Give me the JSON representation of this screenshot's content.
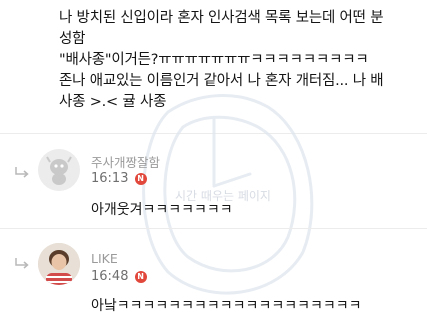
{
  "post": {
    "lines": [
      "나 방치된 신입이라 혼자 인사검색 목록 보는데 어떤 분",
      "성함",
      "\"배사종\"이거든?ㅠㅠㅠㅠㅠㅠㅠㅋㅋㅋㅋㅋㅋㅋㅋㅋ",
      "존나 애교있는 이름인거 같아서 나 혼자 개터짐... 나 배",
      "사종 >.< 귤 사종"
    ]
  },
  "watermark": {
    "text": "시간 때우는 페이지"
  },
  "comments": [
    {
      "author": "주사개짱잘함",
      "time": "16:13",
      "badge": "N",
      "text": "아개웃겨ㅋㅋㅋㅋㅋㅋㅋ",
      "avatar_icon": "gray-character-avatar-icon"
    },
    {
      "author": "LIKE",
      "time": "16:48",
      "badge": "N",
      "text": "아낰ㅋㅋㅋㅋㅋㅋㅋㅋㅋㅋㅋㅋㅋㅋㅋㅋㅋㅋㅋ",
      "avatar_icon": "photo-avatar-icon"
    }
  ],
  "colors": {
    "badge": "#e2473b",
    "author": "#9a9a9a",
    "divider": "#ececec"
  }
}
